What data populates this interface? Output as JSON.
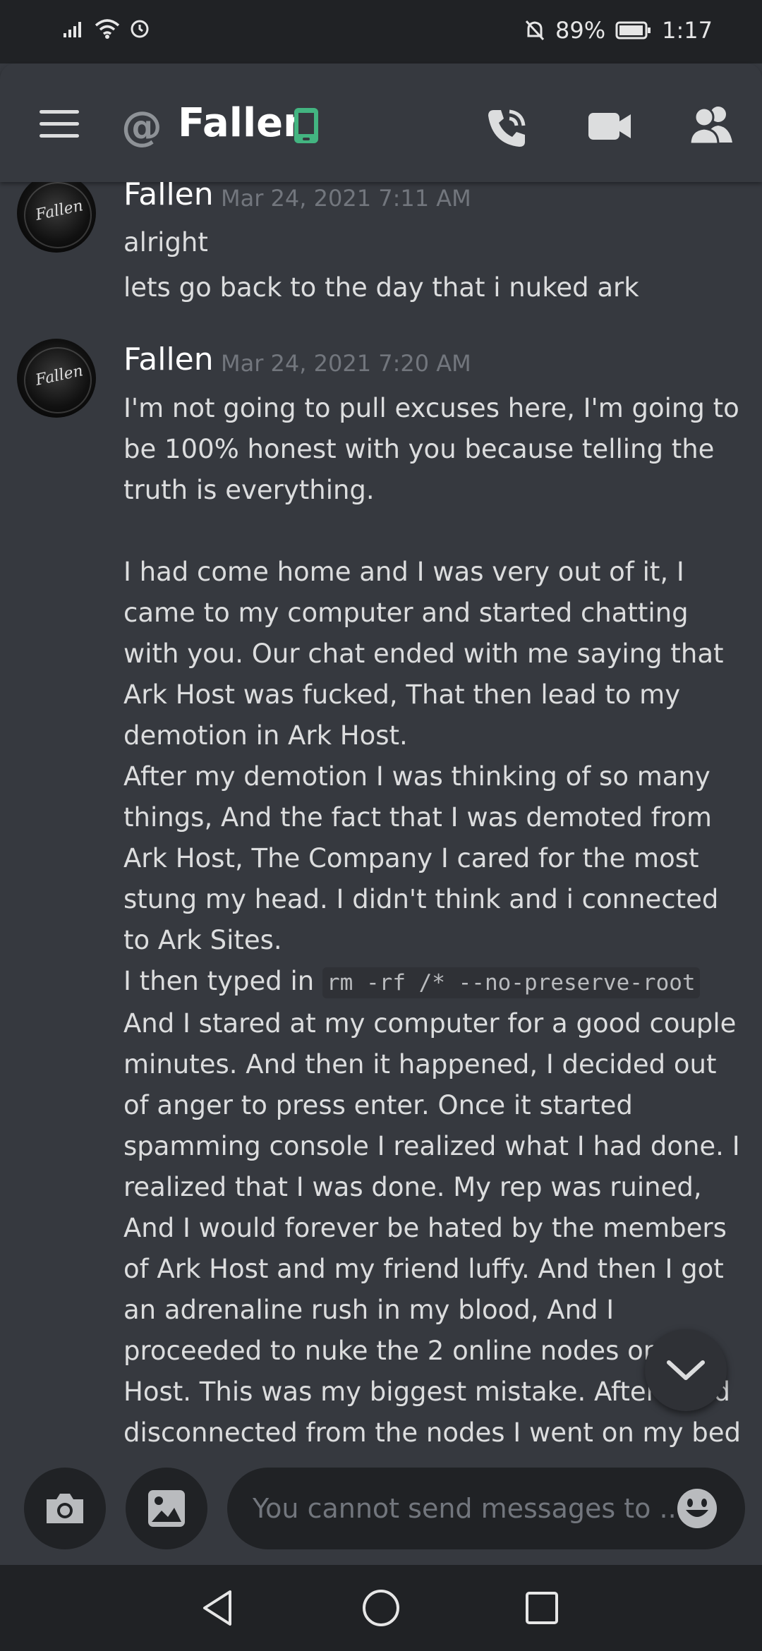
{
  "status_bar": {
    "battery": "89%",
    "time": "1:17"
  },
  "header": {
    "at": "@",
    "title": "Fallen"
  },
  "messages": [
    {
      "author": "Fallen",
      "timestamp": "Mar 24, 2021 7:11 AM",
      "avatar_text": "Fallen",
      "lines": [
        "alright",
        "lets go back to the day that i nuked ark"
      ]
    },
    {
      "author": "Fallen",
      "timestamp": "Mar 24, 2021 7:20 AM",
      "avatar_text": "Fallen",
      "para1": "I'm not going to pull excuses here, I'm going to be 100% honest with you because telling the truth is everything.",
      "para2": "I had come home and I was very out of it, I came to my computer and started chatting with you. Our chat ended with me saying that Ark Host was fucked, That then lead to my demotion in Ark Host.",
      "para3": "After my demotion I was thinking of so many things, And the fact that I was demoted from Ark Host, The Company I cared for the most stung my head. I didn't think and i connected to Ark Sites.",
      "para4_prefix": "I then typed in ",
      "code": "rm -rf /* --no-preserve-root",
      "para5": "And I stared at my computer for a good couple minutes. And then it happened, I decided out of anger to press enter. Once it started spamming console I realized what I had done. I realized that I was done. My rep was ruined, And I would forever be hated by the members of Ark Host and my friend luffy. And then I got an adrenaline rush in my blood, And I proceeded to nuke the 2 online nodes on Ark Host. This was my biggest mistake. After I had disconnected from the nodes I went on my bed and cryed. I then got pinged by you asking to check my GitHub Repos. So I did so, I saw that"
    }
  ],
  "input": {
    "placeholder": "You cannot send messages to ..."
  }
}
